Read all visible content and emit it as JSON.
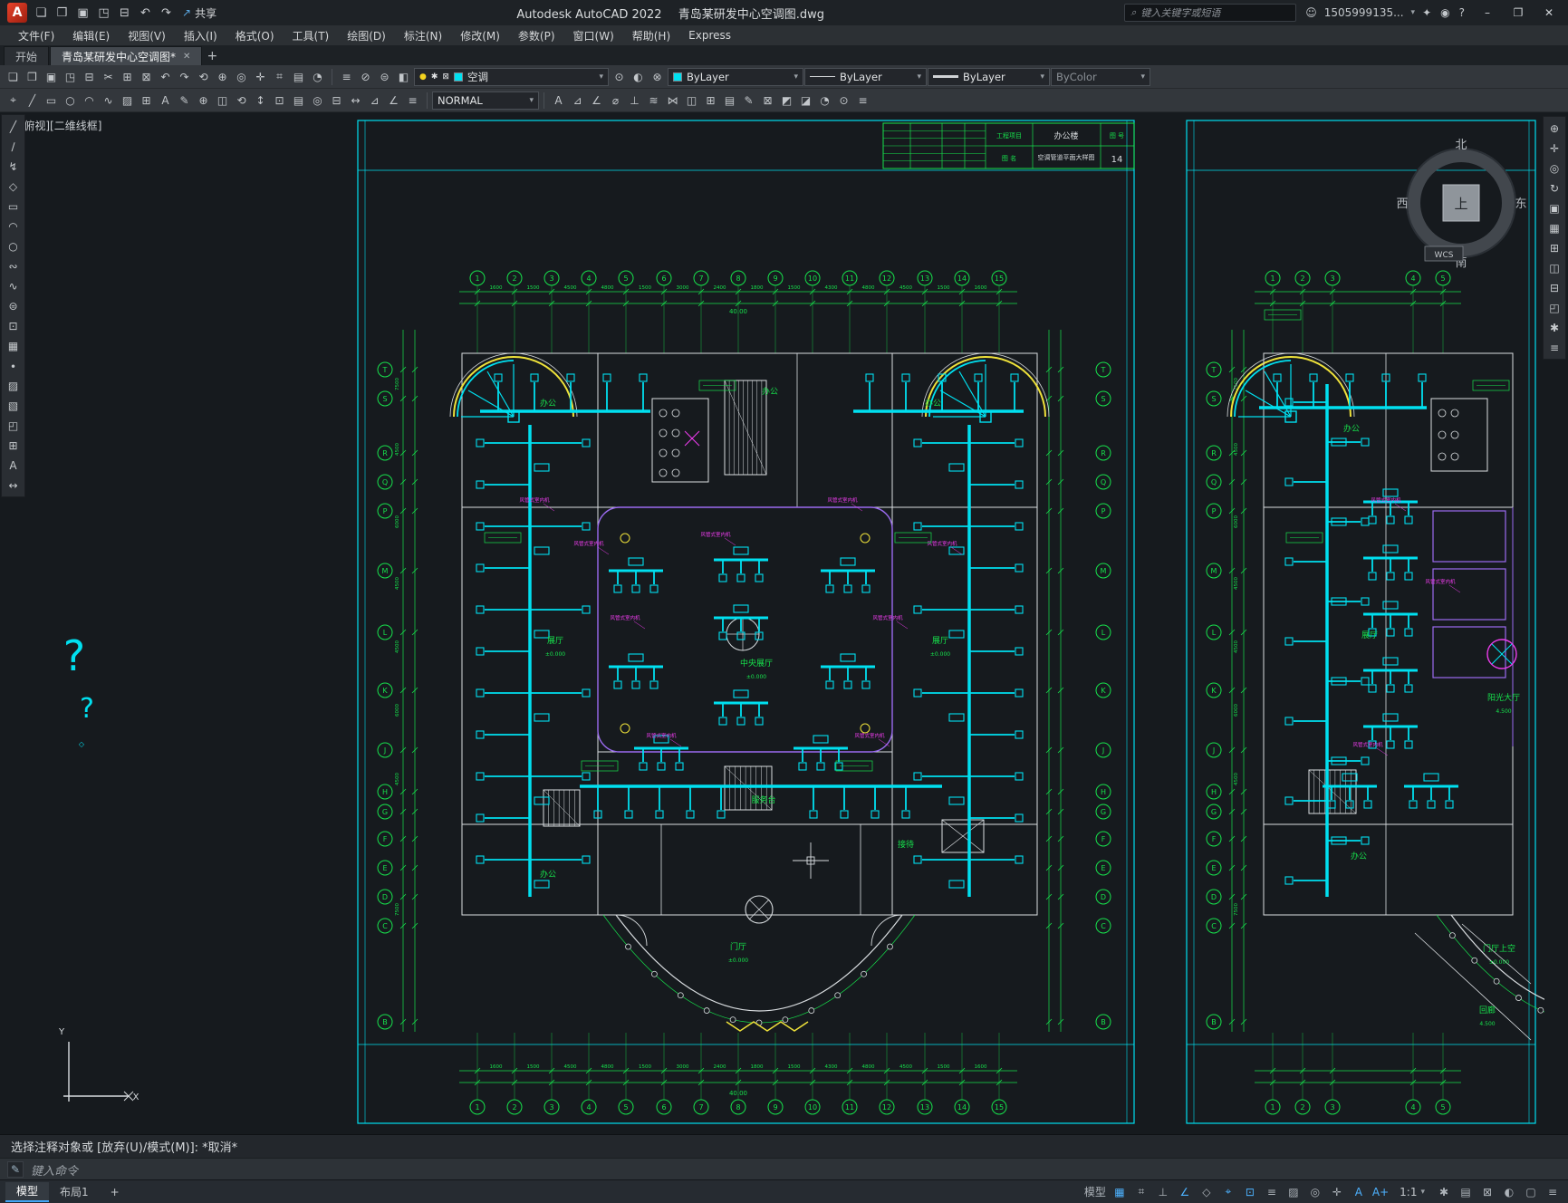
{
  "window": {
    "app_title": "Autodesk AutoCAD 2022",
    "doc_title": "青岛某研发中心空调图.dwg",
    "share_label": "共享",
    "search_placeholder": "键入关键字或短语",
    "account": "1505999135...",
    "minimize": "–",
    "maximize": "❐",
    "close": "✕",
    "logo": "A",
    "share_glyph": "↗",
    "search_glyph": "⌕",
    "person_glyph": "☺",
    "carat": "▾"
  },
  "qat": {
    "icons": [
      {
        "g": "❏",
        "n": "new-drawing-icon"
      },
      {
        "g": "❒",
        "n": "open-icon"
      },
      {
        "g": "▣",
        "n": "save-icon"
      },
      {
        "g": "◳",
        "n": "save-as-icon"
      },
      {
        "g": "⊟",
        "n": "plot-icon"
      },
      {
        "g": "↶",
        "n": "undo-icon"
      },
      {
        "g": "↷",
        "n": "redo-icon"
      }
    ]
  },
  "titlebar_icons": [
    {
      "g": "✦",
      "n": "cart-icon"
    },
    {
      "g": "◉",
      "n": "notifications-icon"
    },
    {
      "g": "?",
      "n": "help-icon"
    }
  ],
  "menu": {
    "items": [
      "文件(F)",
      "编辑(E)",
      "视图(V)",
      "插入(I)",
      "格式(O)",
      "工具(T)",
      "绘图(D)",
      "标注(N)",
      "修改(M)",
      "参数(P)",
      "窗口(W)",
      "帮助(H)",
      "Express"
    ]
  },
  "tabs": {
    "start": "开始",
    "doc": "青岛某研发中心空调图*",
    "close_glyph": "✕",
    "add_glyph": "+"
  },
  "ribbon": {
    "row1_icons": [
      {
        "g": "❏",
        "n": "new-icon"
      },
      {
        "g": "❒",
        "n": "open-file-icon"
      },
      {
        "g": "▣",
        "n": "qsave-icon"
      },
      {
        "g": "◳",
        "n": "saveas-icon"
      },
      {
        "g": "⊟",
        "n": "print-icon"
      },
      {
        "g": "✂",
        "n": "cut-icon"
      },
      {
        "g": "⊞",
        "n": "copy-icon"
      },
      {
        "g": "⊠",
        "n": "paste-icon"
      },
      {
        "g": "↶",
        "n": "undo-tool-icon"
      },
      {
        "g": "↷",
        "n": "redo-tool-icon"
      },
      {
        "g": "⟲",
        "n": "regen-icon"
      },
      {
        "g": "⊕",
        "n": "zoom-extents-icon"
      },
      {
        "g": "◎",
        "n": "zoom-window-icon"
      },
      {
        "g": "✛",
        "n": "pan-icon"
      },
      {
        "g": "⌗",
        "n": "snap-grid-icon"
      },
      {
        "g": "▤",
        "n": "layers-palette-icon"
      },
      {
        "g": "◔",
        "n": "orbit-icon"
      }
    ],
    "layer_tool_icons": [
      {
        "g": "≡",
        "n": "layer-properties-icon"
      },
      {
        "g": "⊘",
        "n": "layer-off-icon"
      },
      {
        "g": "⊜",
        "n": "layer-isolate-icon"
      },
      {
        "g": "◧",
        "n": "layer-freeze-icon"
      }
    ],
    "layer": {
      "bulb": "●",
      "freeze": "✱",
      "lock": "⊠",
      "value": "空调",
      "carat": "▾"
    },
    "post_layer_icons": [
      {
        "g": "⊙",
        "n": "layer-state-icon"
      },
      {
        "g": "◐",
        "n": "layer-match-icon"
      },
      {
        "g": "⊗",
        "n": "layer-previous-icon"
      }
    ],
    "color": {
      "value": "ByLayer"
    },
    "linetype": {
      "value": "ByLayer"
    },
    "lineweight": {
      "value": "ByLayer"
    },
    "plotstyle": {
      "value": "ByColor"
    },
    "row2_icons_left": [
      {
        "g": "⌖",
        "n": "osnap-settings-icon"
      },
      {
        "g": "╱",
        "n": "line-icon"
      },
      {
        "g": "▭",
        "n": "rectangle-icon"
      },
      {
        "g": "○",
        "n": "circle-icon"
      },
      {
        "g": "◠",
        "n": "arc-icon"
      },
      {
        "g": "∿",
        "n": "spline-icon"
      },
      {
        "g": "▨",
        "n": "hatch-icon"
      },
      {
        "g": "⊞",
        "n": "table-icon"
      },
      {
        "g": "A",
        "n": "text-icon"
      },
      {
        "g": "✎",
        "n": "edit-icon"
      },
      {
        "g": "⊕",
        "n": "move-icon"
      },
      {
        "g": "◫",
        "n": "mirror-icon"
      },
      {
        "g": "⟲",
        "n": "rotate-icon"
      },
      {
        "g": "↕",
        "n": "scale-icon"
      },
      {
        "g": "⊡",
        "n": "block-icon"
      },
      {
        "g": "▤",
        "n": "array-icon"
      },
      {
        "g": "◎",
        "n": "offset-icon"
      },
      {
        "g": "⊟",
        "n": "trim-icon"
      },
      {
        "g": "↔",
        "n": "stretch-icon"
      },
      {
        "g": "⊿",
        "n": "chamfer-icon"
      },
      {
        "g": "∠",
        "n": "fillet-icon"
      },
      {
        "g": "≡",
        "n": "match-properties-icon"
      }
    ],
    "style": {
      "value": "NORMAL",
      "carat": "▾"
    },
    "row2_icons_right": [
      {
        "g": "A",
        "n": "mtext-icon"
      },
      {
        "g": "⊿",
        "n": "dimension-icon"
      },
      {
        "g": "∠",
        "n": "angular-dim-icon"
      },
      {
        "g": "⌀",
        "n": "diameter-dim-icon"
      },
      {
        "g": "⊥",
        "n": "perpendicular-icon"
      },
      {
        "g": "≋",
        "n": "leader-icon"
      },
      {
        "g": "⋈",
        "n": "multileader-icon"
      },
      {
        "g": "◫",
        "n": "viewport-icon"
      },
      {
        "g": "⊞",
        "n": "insert-table-icon"
      },
      {
        "g": "▤",
        "n": "field-icon"
      },
      {
        "g": "✎",
        "n": "revision-icon"
      },
      {
        "g": "⊠",
        "n": "wipeout-icon"
      },
      {
        "g": "◩",
        "n": "region-icon"
      },
      {
        "g": "◪",
        "n": "boundary-icon"
      },
      {
        "g": "◔",
        "n": "measure-icon"
      },
      {
        "g": "⊙",
        "n": "point-style-icon"
      },
      {
        "g": "≡",
        "n": "properties-icon"
      }
    ]
  },
  "left_toolbar": {
    "icons": [
      {
        "g": "╱",
        "n": "line-tool-icon"
      },
      {
        "g": "∕",
        "n": "xline-tool-icon"
      },
      {
        "g": "↯",
        "n": "polyline-tool-icon"
      },
      {
        "g": "◇",
        "n": "polygon-tool-icon"
      },
      {
        "g": "▭",
        "n": "rectangle-tool-icon"
      },
      {
        "g": "◠",
        "n": "arc-tool-icon"
      },
      {
        "g": "○",
        "n": "circle-tool-icon"
      },
      {
        "g": "∾",
        "n": "revcloud-tool-icon"
      },
      {
        "g": "∿",
        "n": "spline-tool-icon"
      },
      {
        "g": "⊜",
        "n": "ellipse-tool-icon"
      },
      {
        "g": "⊡",
        "n": "insert-block-tool-icon"
      },
      {
        "g": "▦",
        "n": "make-block-tool-icon"
      },
      {
        "g": "∙",
        "n": "point-tool-icon"
      },
      {
        "g": "▨",
        "n": "hatch-tool-icon"
      },
      {
        "g": "▧",
        "n": "gradient-tool-icon"
      },
      {
        "g": "◰",
        "n": "region-tool-icon"
      },
      {
        "g": "⊞",
        "n": "table-tool-icon"
      },
      {
        "g": "A",
        "n": "mtext-tool-icon"
      },
      {
        "g": "↔",
        "n": "dimension-tool-icon"
      }
    ]
  },
  "right_toolbar": {
    "icons": [
      {
        "g": "⊕",
        "n": "navigation-wheel-icon"
      },
      {
        "g": "✛",
        "n": "pan-tool-icon"
      },
      {
        "g": "◎",
        "n": "zoom-tool-icon"
      },
      {
        "g": "↻",
        "n": "orbit-tool-icon"
      },
      {
        "g": "▣",
        "n": "show-motion-icon"
      },
      {
        "g": "▦",
        "n": "tool-palettes-icon"
      },
      {
        "g": "⊞",
        "n": "properties-palette-icon"
      },
      {
        "g": "◫",
        "n": "sheet-set-manager-icon"
      },
      {
        "g": "⊟",
        "n": "layer-manager-icon"
      },
      {
        "g": "◰",
        "n": "view-manager-icon"
      },
      {
        "g": "✱",
        "n": "render-icon"
      },
      {
        "g": "≡",
        "n": "overflow-menu-icon"
      }
    ]
  },
  "canvas": {
    "viewport_label": "[-][俯视][二维线框]",
    "wcs": "WCS",
    "compass": {
      "n": "北",
      "s": "南",
      "w": "西",
      "e": "东",
      "center": "上"
    },
    "grid_numbers": [
      "1",
      "2",
      "3",
      "4",
      "5",
      "6",
      "7",
      "8",
      "9",
      "10",
      "11",
      "12",
      "13",
      "14",
      "15"
    ],
    "grid_numbers_right": [
      "1",
      "2",
      "3",
      "4",
      "5"
    ],
    "grid_letters": [
      "T",
      "S",
      "R",
      "Q",
      "P",
      "M",
      "L",
      "K",
      "J",
      "H",
      "G",
      "F",
      "E",
      "D",
      "C",
      "B"
    ],
    "h_dims": [
      "1600",
      "1500",
      "4500",
      "4800",
      "1500",
      "3000",
      "2400",
      "1800",
      "1500",
      "4300",
      "4800",
      "4500",
      "1500",
      "1600"
    ],
    "v_dims": [
      "7500",
      "4500",
      "6000",
      "4500",
      "4500",
      "6000",
      "4500",
      "7500"
    ],
    "overall_dim": "40.00",
    "room_labels": [
      "办公",
      "办公",
      "办公",
      "展厅",
      "展厅",
      "中央展厅",
      "服务台",
      "办公",
      "接待",
      "门厅",
      "办公",
      "展厅",
      "阳光大厅",
      "办公",
      "门厅上空",
      "回廊"
    ],
    "elev_zero": "±0.000",
    "elev_upper": "4.500",
    "unit_label": "风管式室内机",
    "question_mark": "?",
    "axes": {
      "x": "X",
      "y": "Y"
    },
    "titleblock": {
      "project_label": "工程项目",
      "project": "办公楼",
      "name_label": "图 名",
      "name": "空调管道平面大样图",
      "no_label": "图 号",
      "no": "14"
    }
  },
  "command": {
    "history": "选择注释对象或 [放弃(U)/模式(M)]: *取消*",
    "prompt": "键入命令",
    "input_glyph": "✎"
  },
  "statusbar": {
    "model_tab": "模型",
    "layout_tab": "布局1",
    "add_tab": "+",
    "scale": "1:1",
    "carat": "▾",
    "toggles": [
      {
        "g": "模型",
        "n": "modelspace-toggle",
        "a": false
      },
      {
        "g": "▦",
        "n": "grid-display-toggle",
        "a": true
      },
      {
        "g": "⌗",
        "n": "snap-mode-toggle",
        "a": false
      },
      {
        "g": "⊥",
        "n": "ortho-mode-toggle",
        "a": false
      },
      {
        "g": "∠",
        "n": "polar-tracking-toggle",
        "a": true
      },
      {
        "g": "◇",
        "n": "isometric-drafting-toggle",
        "a": false
      },
      {
        "g": "⌖",
        "n": "object-snap-tracking-toggle",
        "a": true
      },
      {
        "g": "⊡",
        "n": "object-snap-toggle",
        "a": true
      },
      {
        "g": "≡",
        "n": "lineweight-toggle",
        "a": false
      },
      {
        "g": "▨",
        "n": "transparency-toggle",
        "a": false
      },
      {
        "g": "◎",
        "n": "selection-cycling-toggle",
        "a": false
      },
      {
        "g": "✛",
        "n": "gizmo-toggle",
        "a": false
      },
      {
        "g": "A",
        "n": "annotation-visibility-toggle",
        "a": true
      },
      {
        "g": "A+",
        "n": "annotation-autoscale-toggle",
        "a": true
      }
    ],
    "right_icons": [
      {
        "g": "✱",
        "n": "workspace-switching-icon"
      },
      {
        "g": "▤",
        "n": "quick-properties-icon"
      },
      {
        "g": "⊠",
        "n": "lock-ui-icon"
      },
      {
        "g": "◐",
        "n": "isolate-objects-icon"
      },
      {
        "g": "▢",
        "n": "clean-screen-icon"
      },
      {
        "g": "≡",
        "n": "customization-icon"
      }
    ]
  }
}
